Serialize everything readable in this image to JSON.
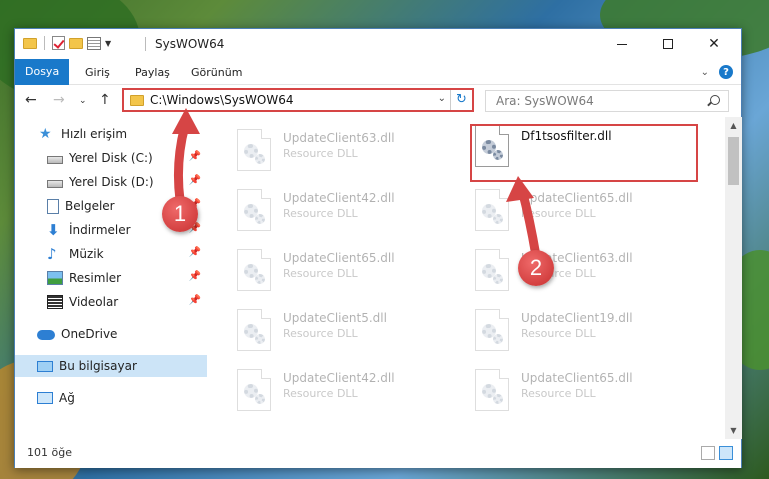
{
  "window": {
    "title": "SysWOW64",
    "controls": {
      "minimize": "–",
      "maximize": "□",
      "close": "✕"
    }
  },
  "ribbon": {
    "tabs": [
      {
        "label": "Dosya",
        "active": true
      },
      {
        "label": "Giriş"
      },
      {
        "label": "Paylaş"
      },
      {
        "label": "Görünüm"
      }
    ],
    "help_label": "?"
  },
  "nav": {
    "address": "C:\\Windows\\SysWOW64",
    "search_placeholder": "Ara: SysWOW64"
  },
  "sidebar": {
    "items": [
      {
        "label": "Hızlı erişim",
        "icon": "star-icon"
      },
      {
        "label": "Yerel Disk (C:)",
        "icon": "drive-icon",
        "pinned": true
      },
      {
        "label": "Yerel Disk (D:)",
        "icon": "drive-icon",
        "pinned": true
      },
      {
        "label": "Belgeler",
        "icon": "documents-icon",
        "pinned": true
      },
      {
        "label": "İndirmeler",
        "icon": "download-icon",
        "pinned": true
      },
      {
        "label": "Müzik",
        "icon": "music-icon",
        "pinned": true
      },
      {
        "label": "Resimler",
        "icon": "pictures-icon",
        "pinned": true
      },
      {
        "label": "Videolar",
        "icon": "videos-icon",
        "pinned": true
      },
      {
        "label": "OneDrive",
        "icon": "cloud-icon"
      },
      {
        "label": "Bu bilgisayar",
        "icon": "computer-icon",
        "selected": true
      },
      {
        "label": "Ağ",
        "icon": "network-icon"
      }
    ]
  },
  "files": {
    "left": [
      {
        "name": "UpdateClient63.dll",
        "type": "Resource DLL"
      },
      {
        "name": "UpdateClient42.dll",
        "type": "Resource DLL"
      },
      {
        "name": "UpdateClient65.dll",
        "type": "Resource DLL"
      },
      {
        "name": "UpdateClient5.dll",
        "type": "Resource DLL"
      },
      {
        "name": "UpdateClient42.dll",
        "type": "Resource DLL"
      }
    ],
    "right": [
      {
        "name": "Df1tsosfilter.dll",
        "type": ""
      },
      {
        "name": "UpdateClient65.dll",
        "type": "Resource DLL"
      },
      {
        "name": "UpdateClient63.dll",
        "type": "Resource DLL"
      },
      {
        "name": "UpdateClient19.dll",
        "type": "Resource DLL"
      },
      {
        "name": "UpdateClient65.dll",
        "type": "Resource DLL"
      }
    ]
  },
  "status": {
    "item_count": "101 öğe"
  },
  "annotations": {
    "marker1": "1",
    "marker2": "2",
    "color": "#d64545"
  },
  "colors": {
    "accent": "#1979ca",
    "selection": "#cce4f7",
    "highlight_red": "#d64545"
  }
}
